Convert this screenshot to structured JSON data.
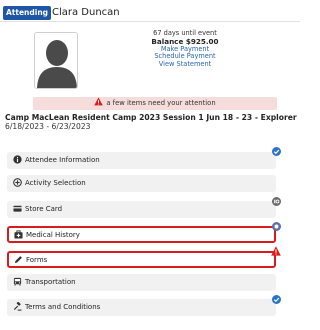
{
  "header": {
    "status_badge": "Attending",
    "attendee_name": "Clara Duncan"
  },
  "summary": {
    "days_until": "67 days until event",
    "balance": "Balance $925.00",
    "make_payment": "Make Payment",
    "schedule_payment": "Schedule Payment",
    "view_statement": "View Statement"
  },
  "alert": {
    "message": "a few items need your attention",
    "icon": "warning-triangle-icon",
    "color": "#d81b1b"
  },
  "event": {
    "title": "Camp MacLean Resident Camp 2023 Session 1 Jun 18 - 23 - Explorer",
    "dates": "6/18/2023 - 6/23/2023"
  },
  "sections": [
    {
      "label": "Attendee Information",
      "icon": "info-circle-icon",
      "status": "complete"
    },
    {
      "label": "Activity Selection",
      "icon": "plus-circle-icon",
      "status": "none"
    },
    {
      "label": "Store Card",
      "icon": "credit-card-icon",
      "status": "count"
    },
    {
      "label": "Medical History",
      "icon": "medical-kit-icon",
      "status": "attention"
    },
    {
      "label": "Forms",
      "icon": "pencil-icon",
      "status": "required"
    },
    {
      "label": "Transportation",
      "icon": "bus-icon",
      "status": "none"
    },
    {
      "label": "Terms and Conditions",
      "icon": "gavel-icon",
      "status": "complete"
    }
  ],
  "colors": {
    "badge": "#1f57a6",
    "link": "#2a66b2",
    "alert_bg": "#f7dcdc",
    "attention_border": "#d81b1b",
    "complete_check": "#2a73c9"
  }
}
